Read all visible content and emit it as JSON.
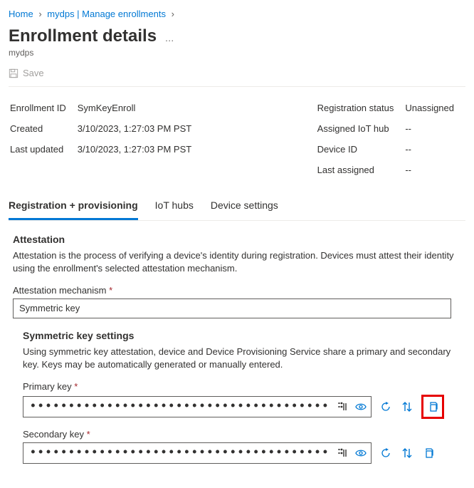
{
  "breadcrumb": {
    "home": "Home",
    "parent": "mydps | Manage enrollments"
  },
  "page": {
    "title": "Enrollment details",
    "subtitle": "mydps",
    "more": "…"
  },
  "toolbar": {
    "save": "Save"
  },
  "details_left": {
    "enrollment_id_label": "Enrollment ID",
    "enrollment_id_value": "SymKeyEnroll",
    "created_label": "Created",
    "created_value": "3/10/2023, 1:27:03 PM PST",
    "last_updated_label": "Last updated",
    "last_updated_value": "3/10/2023, 1:27:03 PM PST"
  },
  "details_right": {
    "reg_status_label": "Registration status",
    "reg_status_value": "Unassigned",
    "hub_label": "Assigned IoT hub",
    "hub_value": "--",
    "device_id_label": "Device ID",
    "device_id_value": "--",
    "last_assigned_label": "Last assigned",
    "last_assigned_value": "--"
  },
  "tabs": {
    "registration": "Registration + provisioning",
    "iot_hubs": "IoT hubs",
    "device_settings": "Device settings"
  },
  "attestation": {
    "heading": "Attestation",
    "desc": "Attestation is the process of verifying a device's identity during registration. Devices must attest their identity using the enrollment's selected attestation mechanism.",
    "mechanism_label": "Attestation mechanism",
    "mechanism_value": "Symmetric key"
  },
  "symkey": {
    "heading": "Symmetric key settings",
    "desc": "Using symmetric key attestation, device and Device Provisioning Service share a primary and secondary key. Keys may be automatically generated or manually entered.",
    "primary_label": "Primary key",
    "secondary_label": "Secondary key",
    "masked": "•••••••••••••••••••••••••••••••••••••••••••••••••••••••••••••••••••••••••••••••••••••••••••••••"
  }
}
